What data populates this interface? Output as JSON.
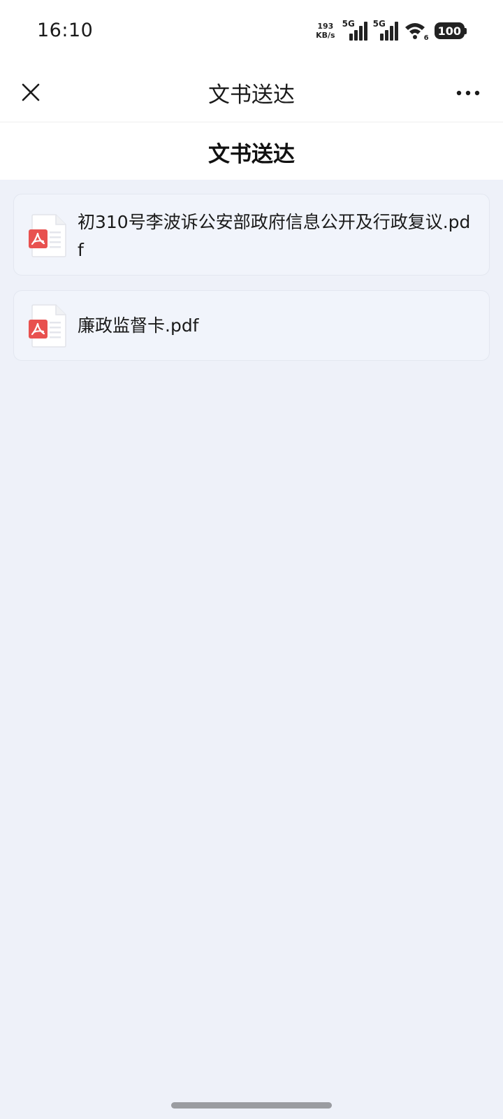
{
  "status_bar": {
    "time": "16:10",
    "net_speed_value": "193",
    "net_speed_unit": "KB/s",
    "signal1_label": "5G",
    "signal2_label": "5G",
    "wifi_label": "6",
    "battery": "100"
  },
  "nav": {
    "title": "文书送达"
  },
  "page": {
    "title": "文书送达"
  },
  "files": [
    {
      "name": "初310号李波诉公安部政府信息公开及行政复议.pdf",
      "icon": "pdf-icon"
    },
    {
      "name": "廉政监督卡.pdf",
      "icon": "pdf-icon"
    }
  ],
  "colors": {
    "background": "#eef1f9",
    "card": "#f1f4fb",
    "pdf_red": "#e8514f"
  }
}
